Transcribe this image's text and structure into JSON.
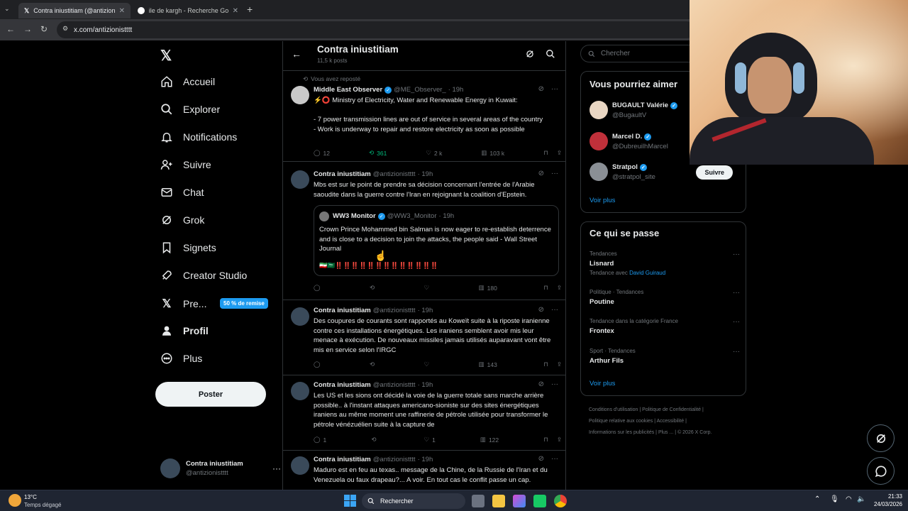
{
  "browser": {
    "tabs": [
      {
        "label": "Contra iniustitiam (@antizionis...",
        "active": true
      },
      {
        "label": "ile de kargh - Recherche Googl...",
        "active": false
      }
    ],
    "url": "x.com/antizionistttt"
  },
  "nav": {
    "items": [
      {
        "label": "Accueil",
        "icon": "home-icon"
      },
      {
        "label": "Explorer",
        "icon": "search-icon"
      },
      {
        "label": "Notifications",
        "icon": "bell-icon"
      },
      {
        "label": "Suivre",
        "icon": "person-plus-icon"
      },
      {
        "label": "Chat",
        "icon": "mail-icon"
      },
      {
        "label": "Grok",
        "icon": "grok-icon"
      },
      {
        "label": "Signets",
        "icon": "bookmark-icon"
      },
      {
        "label": "Creator Studio",
        "icon": "rocket-icon"
      },
      {
        "label": "Pre...",
        "icon": "x-logo-icon"
      },
      {
        "label": "Profil",
        "icon": "person-icon"
      },
      {
        "label": "Plus",
        "icon": "more-circle-icon"
      }
    ],
    "premium_badge": "50 % de remise",
    "post_button": "Poster",
    "account": {
      "name": "Contra iniustitiam",
      "handle": "@antizionistttt"
    }
  },
  "header": {
    "title": "Contra iniustitiam",
    "subtitle": "11,5 k posts"
  },
  "tweets": [
    {
      "repost_label": "Vous avez reposté",
      "name": "Middle East Observer",
      "handle": "@ME_Observer_",
      "time": "· 19h",
      "text": "⚡⭕ Ministry of Electricity, Water and Renewable Energy in Kuwait:\n\n- 7 power transmission lines are out of service in several areas of the country\n- Work is underway to repair and restore electricity as soon as possible",
      "replies": "12",
      "reposts": "361",
      "likes": "2 k",
      "views": "103 k"
    },
    {
      "name": "Contra iniustitiam",
      "handle": "@antizionistttt",
      "time": "· 19h",
      "text": "Mbs est sur le point de prendre sa décision concernant l'entrée de l'Arabie saoudite dans la guerre contre l'Iran en rejoignant la coalition d'Epstein.",
      "quote": {
        "name": "WW3 Monitor",
        "handle": "@WW3_Monitor",
        "time": "· 19h",
        "text": "Crown Prince Mohammed bin Salman is now eager to re-establish deterrence  and is close to a decision to join the attacks, the people said - Wall Street Journal",
        "emoji_line": "🇮🇷🇸🇦‼️‼️‼️‼️‼️‼️‼️‼️‼️‼️‼️‼️‼️"
      },
      "replies": "",
      "reposts": "",
      "likes": "",
      "views": "180"
    },
    {
      "name": "Contra iniustitiam",
      "handle": "@antizionistttt",
      "time": "· 19h",
      "text": "Des coupures de courants sont rapportés au Koweït suite à la riposte iranienne contre ces installations énergétiques. Les iraniens semblent avoir mis leur menace à exécution. De nouveaux missiles jamais utilisés auparavant vont être mis en service selon l'IRGC",
      "replies": "",
      "reposts": "",
      "likes": "",
      "views": "143"
    },
    {
      "name": "Contra iniustitiam",
      "handle": "@antizionistttt",
      "time": "· 19h",
      "text": "Les US et les sions ont décidé la voie de la guerre totale sans marche arrière possible.. à l'instant attaques americano-sioniste sur des sites énergétiques iraniens au même moment une raffinerie de pétrole utilisée pour transformer le pétrole vénézuélien suite à la capture de",
      "replies": "1",
      "reposts": "",
      "likes": "1",
      "views": "122"
    },
    {
      "name": "Contra iniustitiam",
      "handle": "@antizionistttt",
      "time": "· 19h",
      "text": "Maduro est en feu au texas.. message de la Chine, de la Russie de l'Iran et du Venezuela ou faux drapeau?... A voir. En tout cas le conflit passe un cap."
    }
  ],
  "right": {
    "search_placeholder": "Chercher",
    "suggestions_title": "Vous pourriez aimer",
    "suggestions": [
      {
        "name": "BUGAULT Valérie",
        "handle": "@BugaultV"
      },
      {
        "name": "Marcel D.",
        "handle": "@DubreuilhMarcel"
      },
      {
        "name": "Stratpol",
        "handle": "@stratpol_site",
        "button": "Suivre"
      }
    ],
    "see_more": "Voir plus",
    "trends_title": "Ce qui se passe",
    "trends": [
      {
        "meta": "Tendances",
        "title": "Lisnard",
        "extra_prefix": "Tendance avec",
        "extra_link": "David Guiraud"
      },
      {
        "meta": "Politique · Tendances",
        "title": "Poutine"
      },
      {
        "meta": "Tendance dans la catégorie France",
        "title": "Frontex"
      },
      {
        "meta": "Sport · Tendances",
        "title": "Arthur Fils"
      }
    ],
    "trends_see_more": "Voir plus",
    "footer": {
      "line1": [
        "Conditions d'utilisation",
        "Politique de Confidentialité"
      ],
      "line2": [
        "Politique relative aux cookies",
        "Accessibilité"
      ],
      "line3": [
        "Informations sur les publicités",
        "Plus ...",
        "© 2026 X Corp."
      ]
    }
  },
  "taskbar": {
    "weather_temp": "13°C",
    "weather_text": "Temps dégagé",
    "search": "Rechercher",
    "time": "21:33",
    "date": "24/03/2026"
  },
  "colors": {
    "accent": "#1d9bf0",
    "repost_green": "#00ba7c",
    "border": "#2f3336",
    "muted": "#71767b"
  }
}
